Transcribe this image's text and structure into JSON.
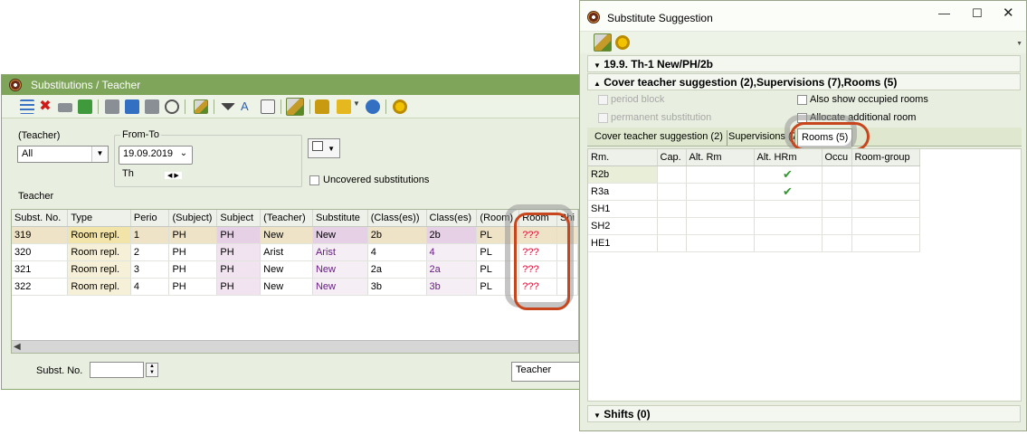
{
  "left_window": {
    "title": "Substitutions / Teacher",
    "filter": {
      "group_label": "(Teacher)",
      "teacher_value": "All",
      "from_to_label": "From-To",
      "date_value": "19.09.2019",
      "day": "Th",
      "uncovered_label": "Uncovered substitutions",
      "section_label": "Teacher"
    },
    "columns": [
      "Subst. No.",
      "Type",
      "Perio",
      "(Subject)",
      "Subject",
      "(Teacher)",
      "Substitute",
      "(Class(es))",
      "Class(es)",
      "(Room)",
      "Room",
      "Shi"
    ],
    "rows": [
      {
        "no": "319",
        "type": "Room repl.",
        "period": "1",
        "subj_orig": "PH",
        "subj": "PH",
        "teacher_orig": "New",
        "substitute": "New",
        "class_orig": "2b",
        "class": "2b",
        "room_orig": "PL",
        "room": "???"
      },
      {
        "no": "320",
        "type": "Room repl.",
        "period": "2",
        "subj_orig": "PH",
        "subj": "PH",
        "teacher_orig": "Arist",
        "substitute": "Arist",
        "class_orig": "4",
        "class": "4",
        "room_orig": "PL",
        "room": "???"
      },
      {
        "no": "321",
        "type": "Room repl.",
        "period": "3",
        "subj_orig": "PH",
        "subj": "PH",
        "teacher_orig": "New",
        "substitute": "New",
        "class_orig": "2a",
        "class": "2a",
        "room_orig": "PL",
        "room": "???"
      },
      {
        "no": "322",
        "type": "Room repl.",
        "period": "4",
        "subj_orig": "PH",
        "subj": "PH",
        "teacher_orig": "New",
        "substitute": "New",
        "class_orig": "3b",
        "class": "3b",
        "room_orig": "PL",
        "room": "???"
      }
    ],
    "footer": {
      "subst_no_label": "Subst. No.",
      "subst_no_value": "",
      "view_value": "Teacher"
    }
  },
  "right_window": {
    "title": "Substitute Suggestion",
    "section1": "19.9. Th-1 New/PH/2b",
    "section2": "Cover teacher suggestion (2),Supervisions (7),Rooms (5)",
    "options": {
      "period_block": "period block",
      "permanent_substitution": "permanent substitution",
      "also_show_occupied": "Also show occupied rooms",
      "allocate_additional": "Allocate additional room"
    },
    "tabs": [
      "Cover teacher suggestion (2)",
      "Supervisions (7)",
      "Rooms (5)"
    ],
    "room_columns": [
      "Rm.",
      "Cap.",
      "Alt. Rm",
      "Alt. HRm",
      "Occu",
      "Room-group"
    ],
    "rooms": [
      {
        "rm": "R2b",
        "alt_hrm_checked": true
      },
      {
        "rm": "R3a",
        "alt_hrm_checked": true
      },
      {
        "rm": "SH1",
        "alt_hrm_checked": false
      },
      {
        "rm": "SH2",
        "alt_hrm_checked": false
      },
      {
        "rm": "HE1",
        "alt_hrm_checked": false
      }
    ],
    "shifts": "Shifts (0)"
  },
  "icons": [
    "clock-icon",
    "list-icon",
    "delete-icon",
    "gear-icon",
    "pencil-icon",
    "lock-icon",
    "filter-icon",
    "checkmark-icon"
  ],
  "colors": {
    "title_green": "#7ea55a",
    "highlight": "#c8461e",
    "room_unknown": "#e0103a"
  }
}
